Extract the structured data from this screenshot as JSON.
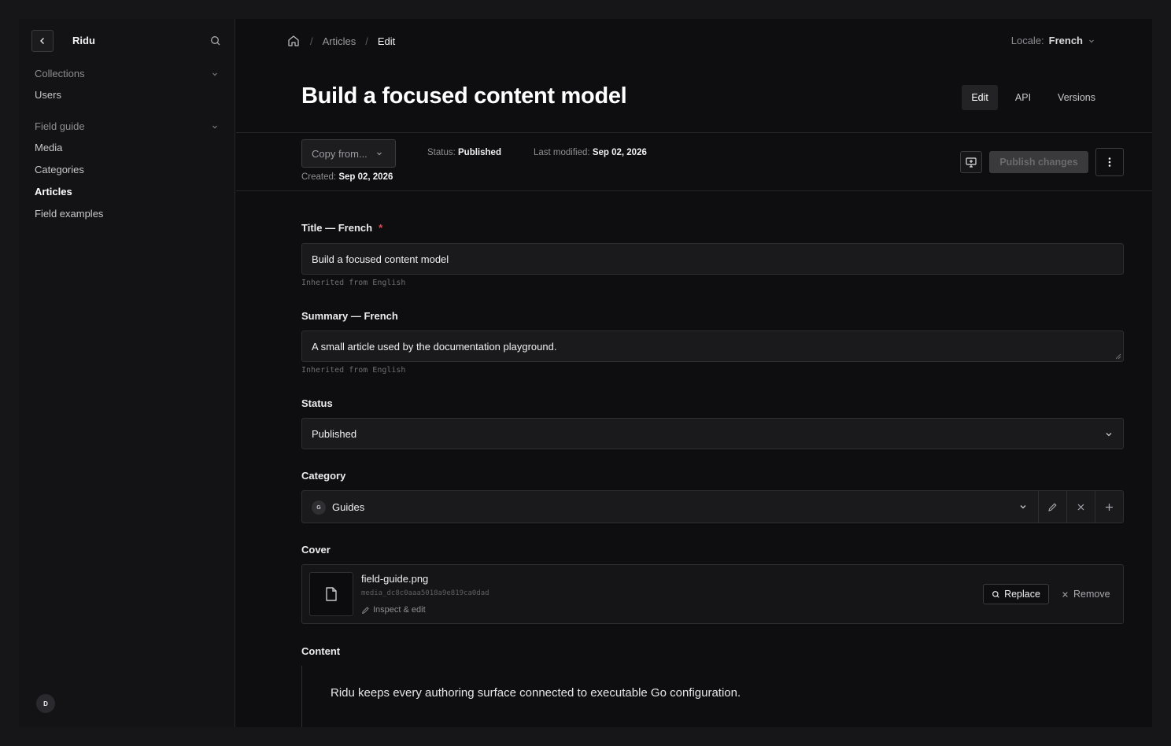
{
  "sidebar": {
    "brand": "Ridu",
    "groups": [
      {
        "label": "Collections",
        "items": [
          "Users"
        ]
      },
      {
        "label": "Field guide",
        "items": [
          "Media",
          "Categories",
          "Articles",
          "Field examples"
        ]
      }
    ],
    "active_item": "Articles",
    "avatar_initial": "D"
  },
  "breadcrumb": {
    "section": "Articles",
    "current": "Edit"
  },
  "locale": {
    "label": "Locale:",
    "value": "French"
  },
  "page": {
    "title": "Build a focused content model",
    "tabs": [
      "Edit",
      "API",
      "Versions"
    ],
    "active_tab": "Edit"
  },
  "toolbar": {
    "copy_from": "Copy from...",
    "status_label": "Status:",
    "status_value": "Published",
    "modified_label": "Last modified:",
    "modified_value": "Sep 02, 2026",
    "created_label": "Created:",
    "created_value": "Sep 02, 2026",
    "publish_label": "Publish changes"
  },
  "fields": {
    "title": {
      "label": "Title — French",
      "required_mark": "*",
      "value": "Build a focused content model",
      "hint": "Inherited from English"
    },
    "summary": {
      "label": "Summary — French",
      "value": "A small article used by the documentation playground.",
      "hint": "Inherited from English"
    },
    "status": {
      "label": "Status",
      "value": "Published"
    },
    "category": {
      "label": "Category",
      "badge": "G",
      "value": "Guides"
    },
    "cover": {
      "label": "Cover",
      "file_name": "field-guide.png",
      "file_id": "media_dc8c0aaa5018a9e819ca0dad",
      "inspect_label": "Inspect & edit",
      "replace_label": "Replace",
      "remove_label": "Remove"
    },
    "content": {
      "label": "Content",
      "text": "Ridu keeps every authoring surface connected to executable Go configuration."
    }
  },
  "colors": {
    "background": "#0e0e10",
    "sidebar": "#131315",
    "required": "#e5484d",
    "publish_disabled": "#3a3a3c"
  }
}
